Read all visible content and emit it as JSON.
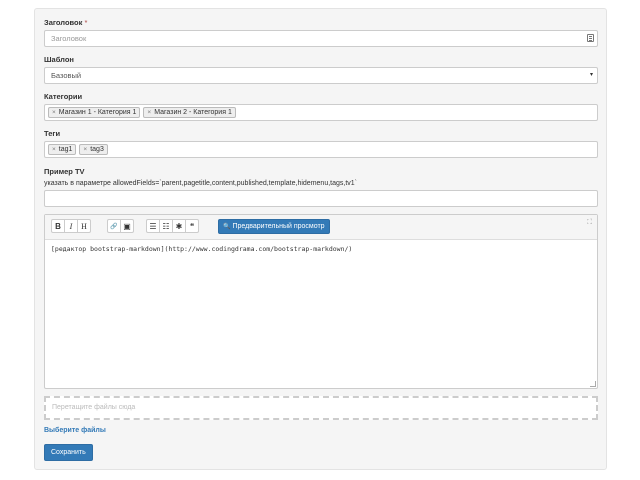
{
  "form": {
    "title_label": "Заголовок",
    "required_mark": "*",
    "title_placeholder": "Заголовок",
    "template_label": "Шаблон",
    "template_value": "Базовый",
    "categories_label": "Категории",
    "categories": [
      "Магазин 1 - Категория 1",
      "Магазин 2 - Категория 1"
    ],
    "tags_label": "Теги",
    "tags": [
      "tag1",
      "tag3"
    ],
    "tv_label": "Пример TV",
    "tv_hint": "указать в параметре allowedFields=`parent,pagetitle,content,published,template,hidemenu,tags,tv1`",
    "tv_value": ""
  },
  "editor": {
    "preview_label": "Предварительный просмотр",
    "content": "[редактор bootstrap-markdown](http://www.codingdrama.com/bootstrap-markdown/)",
    "toolbar_glyphs": {
      "bold": "B",
      "italic": "I",
      "heading": "H",
      "link": "🔗",
      "image": "▣",
      "list_ul": "☰",
      "list_ol": "☷",
      "code": "✱",
      "quote": "❝",
      "search": "🔍",
      "fullscreen": "⛶",
      "remove": "×",
      "caret": "▾"
    }
  },
  "upload": {
    "dropzone_placeholder": "Перетащите файлы сюда",
    "choose_files": "Выберите файлы"
  },
  "actions": {
    "save": "Сохранить"
  }
}
